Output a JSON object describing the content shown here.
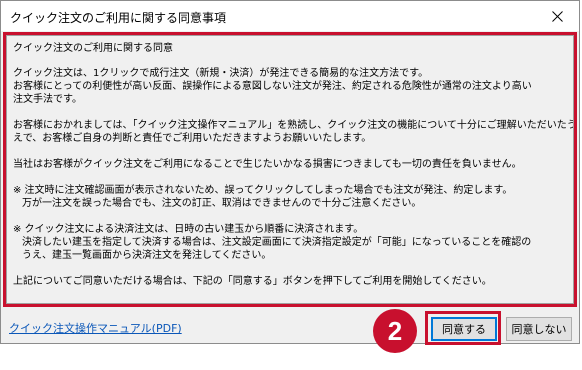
{
  "window": {
    "title": "クイック注文のご利用に関する同意事項"
  },
  "content": {
    "heading": "クイック注文のご利用に関する同意",
    "para1_lines": [
      "クイック注文は、1クリックで成行注文（新規・決済）が発注できる簡易的な注文方法です。",
      "お客様にとっての利便性が高い反面、誤操作による意図しない注文が発注、約定される危険性が通常の注文より高い",
      "注文手法です。"
    ],
    "para2_lines": [
      "お客様におかれましては、「クイック注文操作マニュアル」を熟読し、クイック注文の機能について十分にご理解いただいたう",
      "えで、お客様ご自身の判断と責任でご利用いただきますようお願いいたします。"
    ],
    "para3": "当社はお客様がクイック注文をご利用になることで生じたいかなる損害につきましても一切の責任を負いません。",
    "note1_lines": [
      "※ 注文時に注文確認画面が表示されないため、誤ってクリックしてしまった場合でも注文が発注、約定します。",
      "万が一注文を誤った場合でも、注文の訂正、取消はできませんので十分ご注意ください。"
    ],
    "note2_lines": [
      "※ クイック注文による決済注文は、日時の古い建玉から順番に決済されます。",
      "決済したい建玉を指定して決済する場合は、注文設定画面にて決済指定設定が「可能」になっていることを確認の",
      "うえ、建玉一覧画面から決済注文を発注してください。"
    ],
    "closing": "上記についてご同意いただける場合は、下記の「同意する」ボタンを押下してご利用を開始してください。"
  },
  "footer": {
    "manual_link": "クイック注文操作マニュアル(PDF)",
    "agree_label": "同意する",
    "disagree_label": "同意しない"
  },
  "annotation": {
    "step_number": "2",
    "accent_color": "#c8102e"
  },
  "icons": {
    "close": "close-icon"
  }
}
